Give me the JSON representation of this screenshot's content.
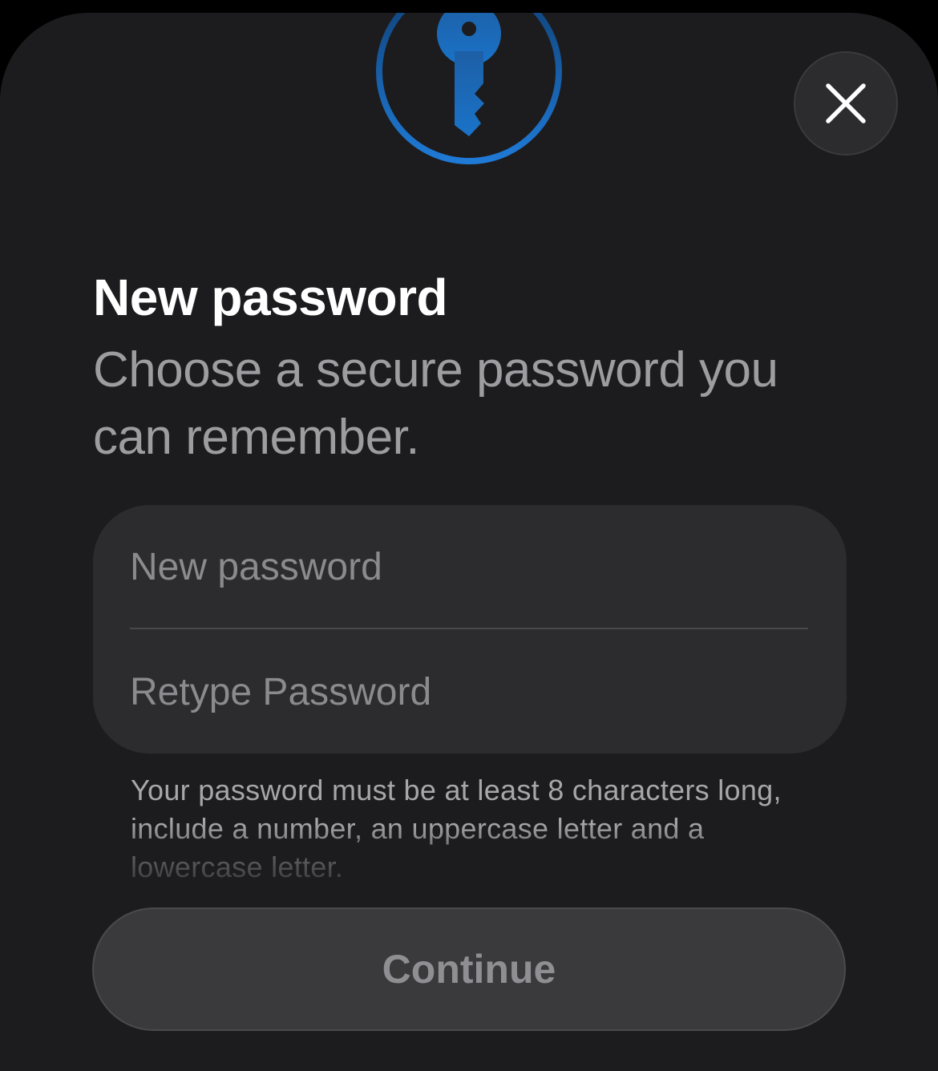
{
  "dialog": {
    "title": "New password",
    "subtitle": "Choose a secure password you can remember.",
    "close_icon": "close-icon",
    "badge_icon": "key-icon"
  },
  "form": {
    "new_password": {
      "value": "",
      "placeholder": "New password"
    },
    "retype_password": {
      "value": "",
      "placeholder": "Retype Password"
    },
    "hint": "Your password must be at least 8 characters long, include a number, an uppercase letter and a lowercase letter."
  },
  "actions": {
    "continue_label": "Continue"
  },
  "colors": {
    "accent": "#1a73c8",
    "background": "#1c1c1e",
    "field_background": "#2c2c2e"
  }
}
